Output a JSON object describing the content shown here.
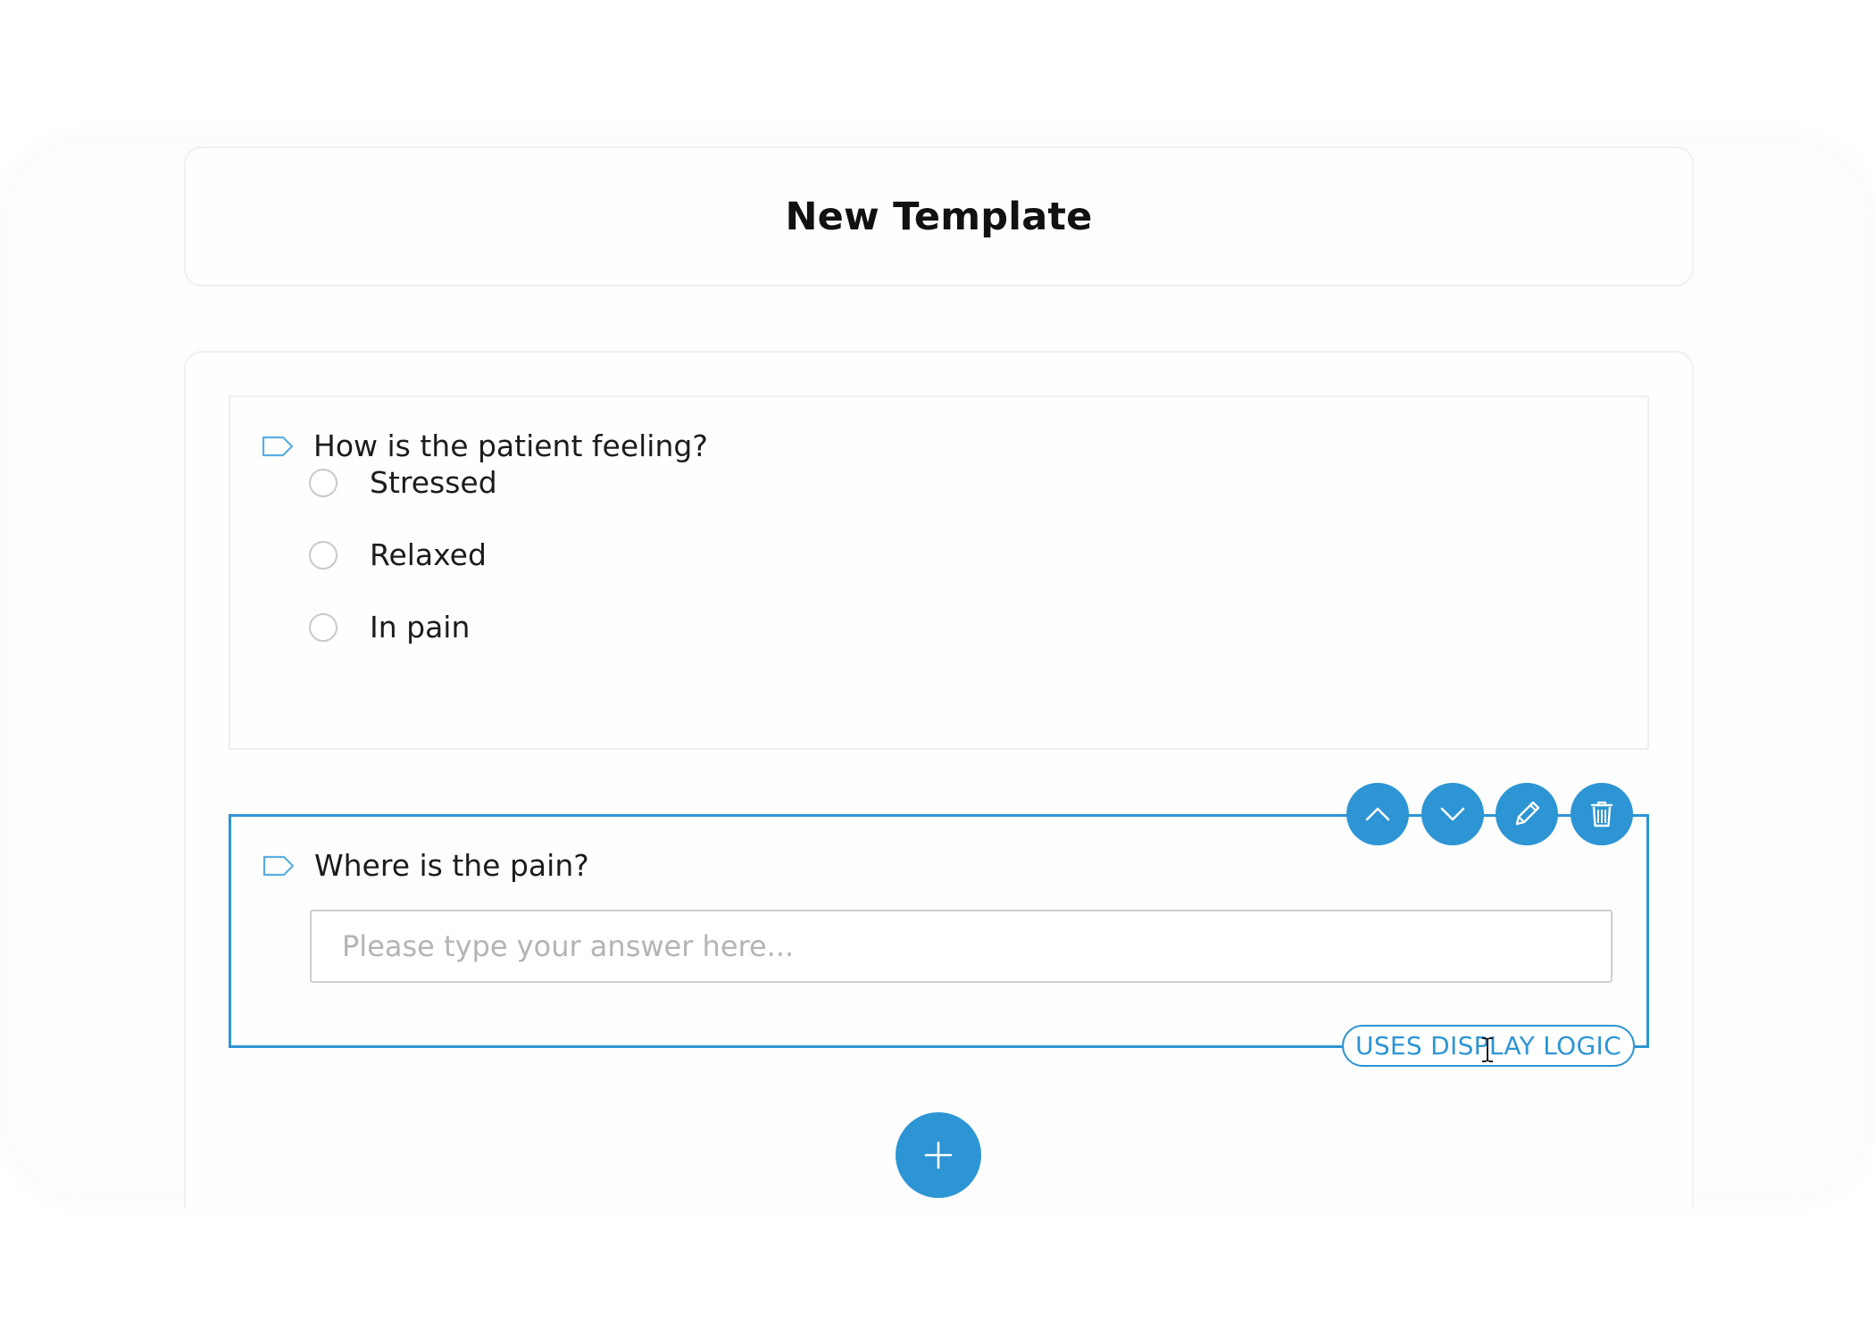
{
  "page": {
    "title": "New Template"
  },
  "questions": [
    {
      "label": "How is the patient feeling?",
      "type": "radio",
      "options": [
        "Stressed",
        "Relaxed",
        "In pain"
      ]
    },
    {
      "label": "Where is the pain?",
      "type": "text",
      "placeholder": "Please type your answer here...",
      "value": "",
      "badge": "USES DISPLAY LOGIC",
      "actions": {
        "move_up_icon": "chevron-up-icon",
        "move_down_icon": "chevron-down-icon",
        "edit_icon": "pencil-icon",
        "delete_icon": "trash-icon"
      }
    }
  ],
  "add_question_icon": "plus-icon",
  "colors": {
    "accent": "#2d95d4",
    "tag_outline": "#5aaee0",
    "radio_border": "#c9c9c9",
    "card_border": "#f0f0f0"
  }
}
